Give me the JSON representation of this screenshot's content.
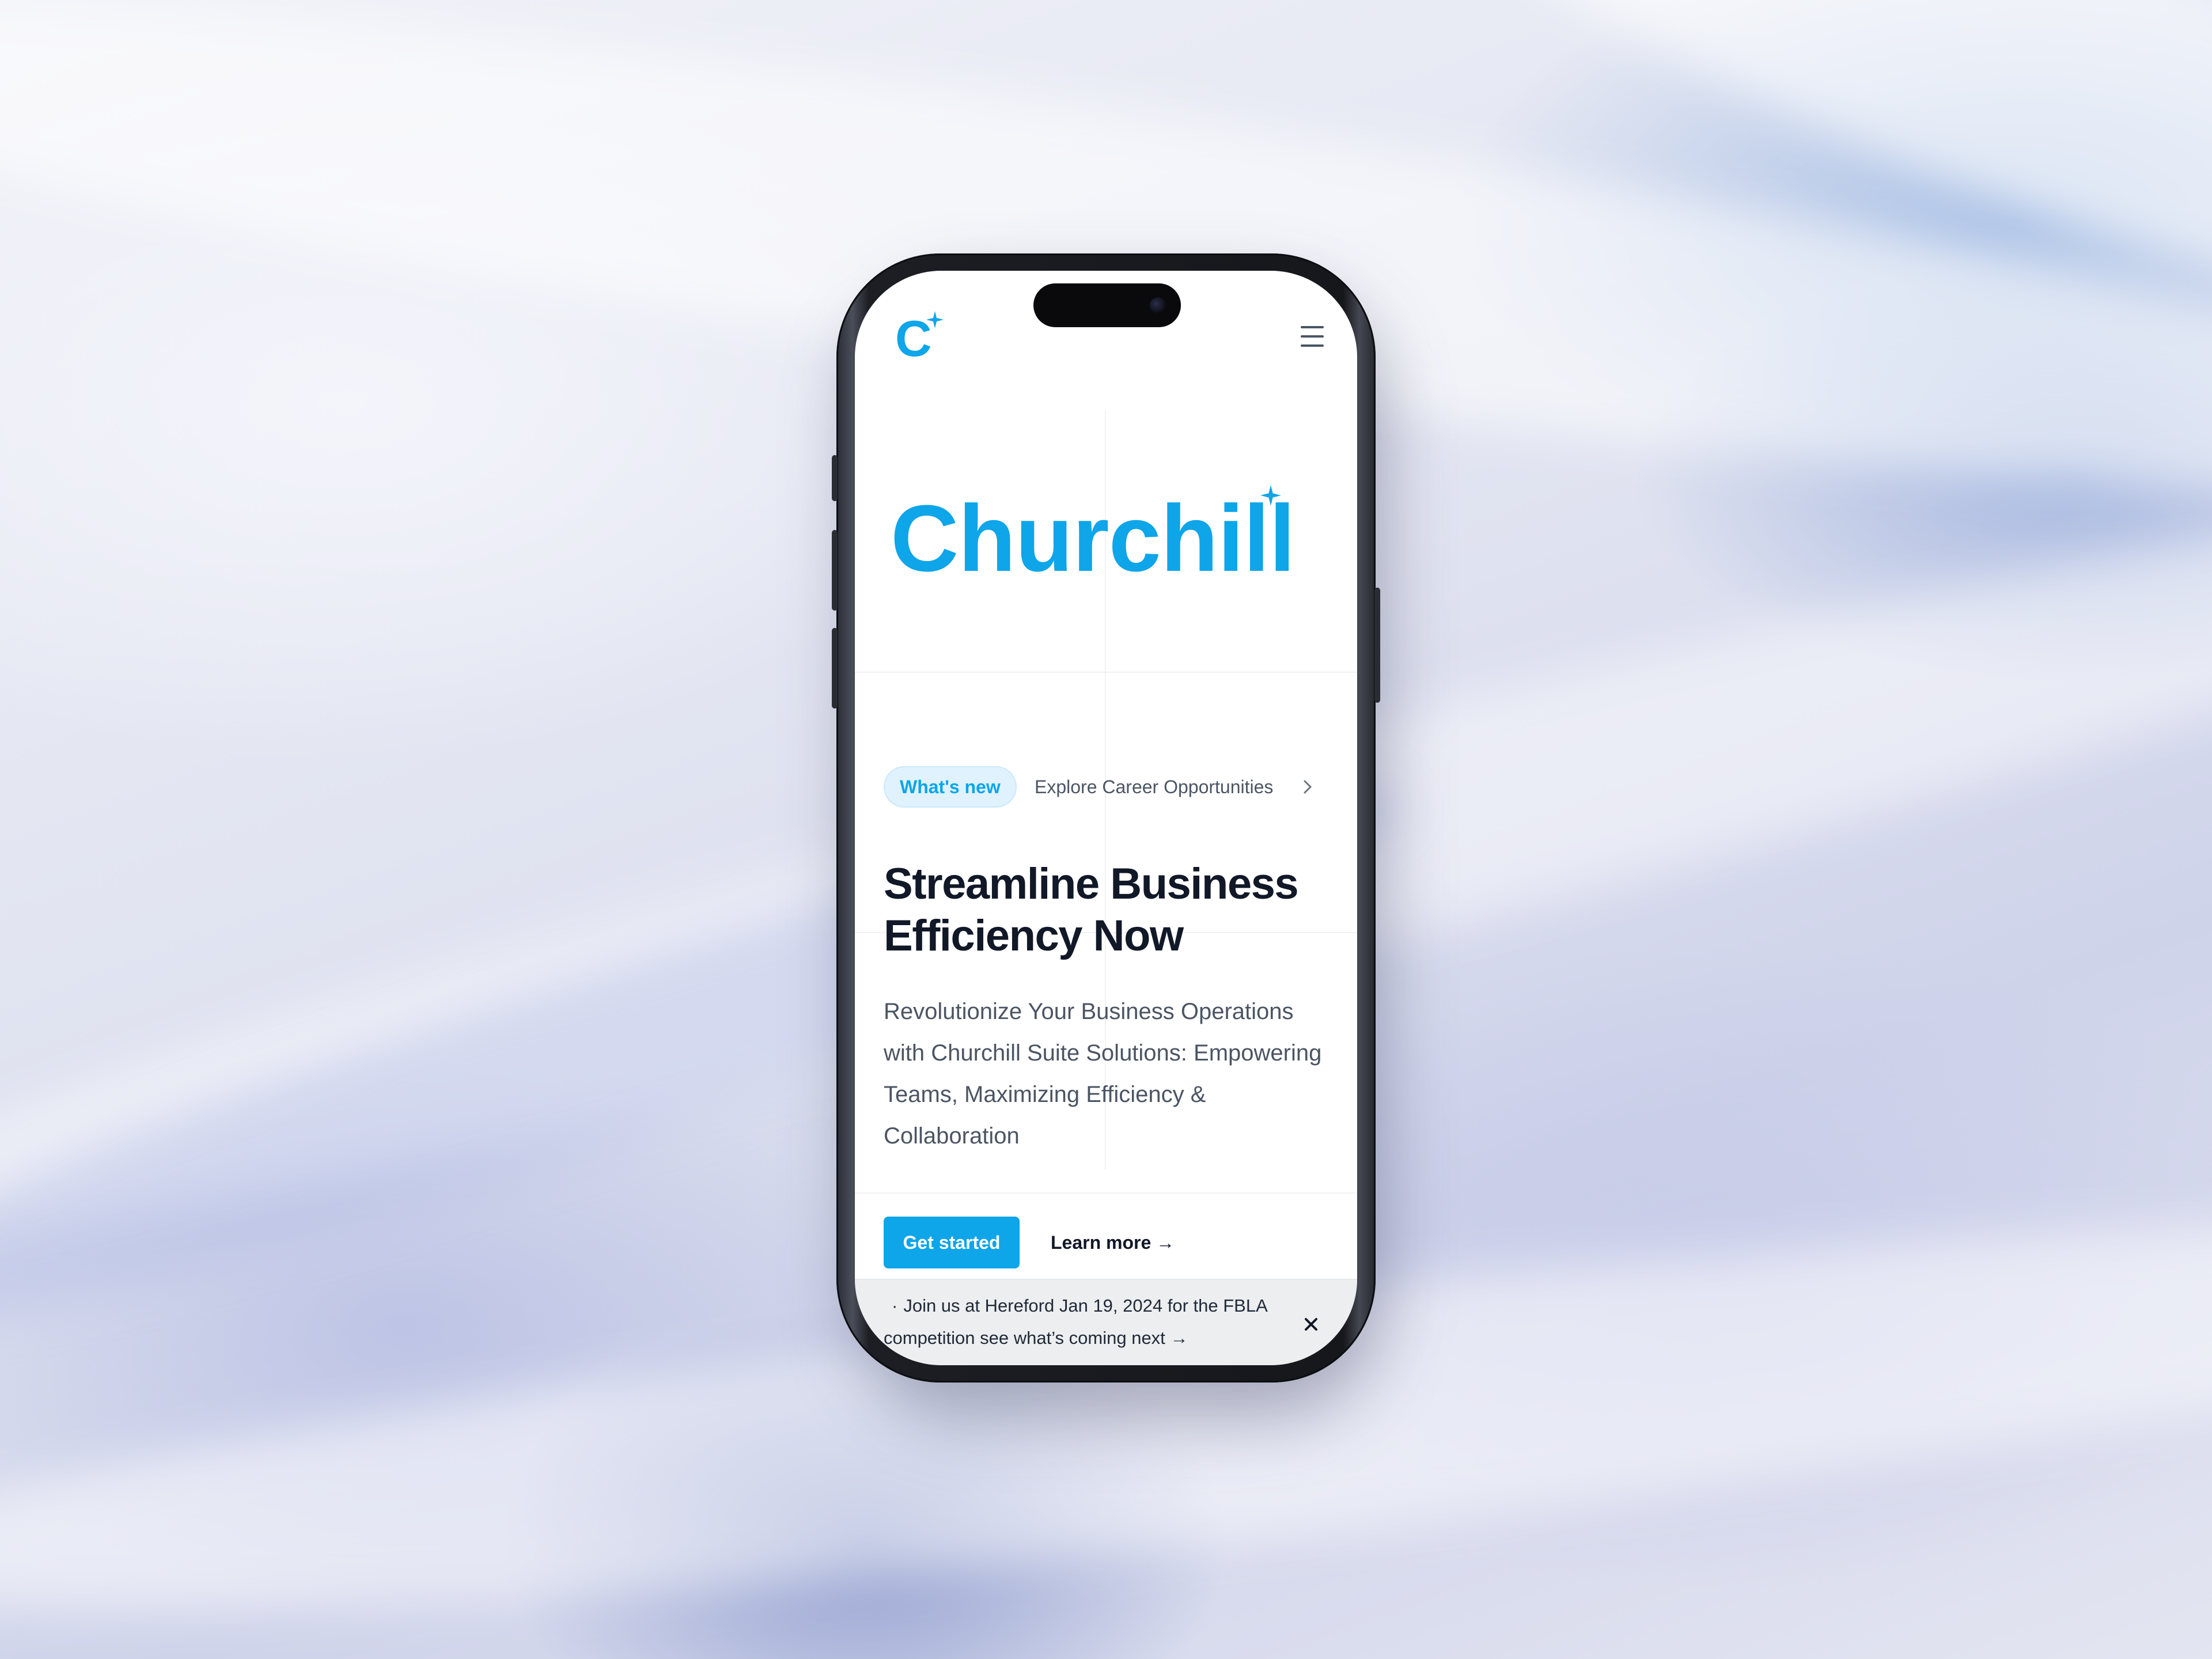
{
  "header": {
    "logo_letter": "C",
    "logo_alt": "Churchill logo",
    "menu_icon": "hamburger-menu-icon"
  },
  "brand": {
    "wordmark": "Churchill"
  },
  "announcement": {
    "badge": "What's new",
    "link_text": "Explore Career Opportunities"
  },
  "hero": {
    "headline": "Streamline Business Efficiency Now",
    "subtext": "Revolutionize Your Business Operations with Churchill Suite Solutions: Empowering Teams, Maximizing Efficiency & Collaboration",
    "primary_cta": "Get started",
    "secondary_cta": "Learn more →"
  },
  "banner": {
    "bullet": "·",
    "text": "Join us at Hereford Jan 19, 2024 for the FBLA competition see what’s coming next →",
    "close_icon": "close-icon"
  },
  "colors": {
    "brand": "#0ea5e9",
    "headline": "#111827",
    "body_text": "#4b5563",
    "badge_bg": "#e0f2fe"
  }
}
